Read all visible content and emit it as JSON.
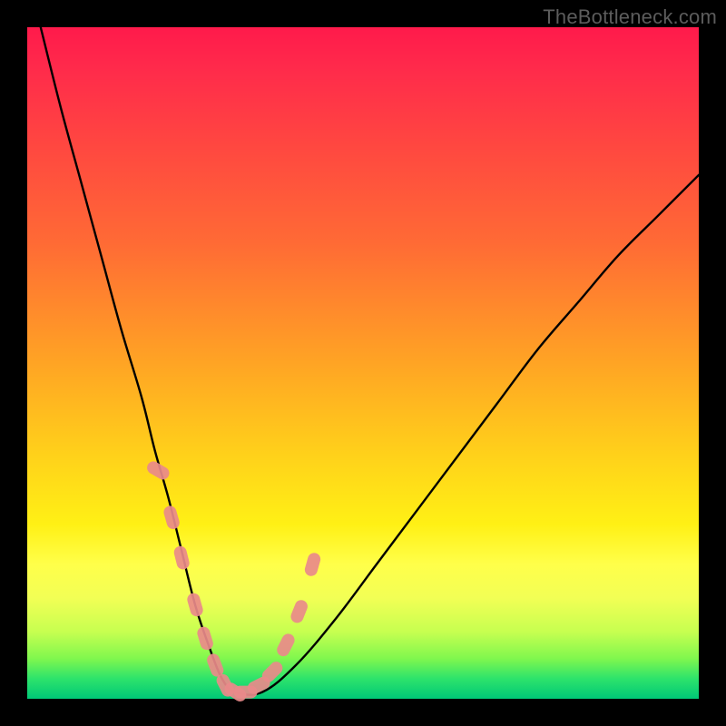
{
  "watermark": "TheBottleneck.com",
  "chart_data": {
    "type": "line",
    "title": "",
    "xlabel": "",
    "ylabel": "",
    "xlim": [
      0,
      100
    ],
    "ylim": [
      0,
      100
    ],
    "series": [
      {
        "name": "bottleneck-curve",
        "x": [
          2,
          5,
          8,
          11,
          14,
          17,
          19,
          21,
          23,
          25,
          27,
          29,
          31,
          35,
          40,
          46,
          52,
          58,
          64,
          70,
          76,
          82,
          88,
          94,
          100
        ],
        "values": [
          100,
          88,
          77,
          66,
          55,
          45,
          37,
          30,
          22,
          14,
          8,
          3,
          1,
          1,
          5,
          12,
          20,
          28,
          36,
          44,
          52,
          59,
          66,
          72,
          78
        ]
      }
    ],
    "highlight_points": {
      "name": "curve-markers",
      "x": [
        19.5,
        21.5,
        23,
        25,
        26.5,
        28,
        29.5,
        31,
        32.5,
        34.5,
        36.5,
        38.5,
        40.5,
        42.5
      ],
      "values": [
        34,
        27,
        21,
        14,
        9,
        5,
        2,
        1,
        1,
        2,
        4,
        8,
        13,
        20
      ]
    },
    "gradient_stops": [
      {
        "pos": 0,
        "color": "#ff1a4b"
      },
      {
        "pos": 18,
        "color": "#ff4840"
      },
      {
        "pos": 50,
        "color": "#ffa424"
      },
      {
        "pos": 74,
        "color": "#fff015"
      },
      {
        "pos": 90,
        "color": "#c7ff50"
      },
      {
        "pos": 100,
        "color": "#00c877"
      }
    ]
  }
}
